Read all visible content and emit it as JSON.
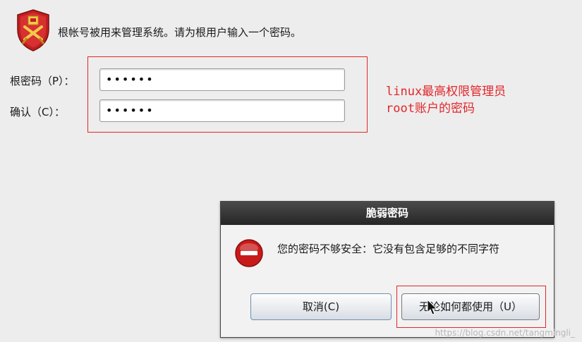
{
  "header": {
    "icon": "shield-lock-icon",
    "text": "根帐号被用来管理系统。请为根用户输入一个密码。"
  },
  "form": {
    "root_password_label": "根密码（P）：",
    "root_password_value": "••••••",
    "confirm_label": "确认（C）：",
    "confirm_value": "••••••"
  },
  "annotation": {
    "line1": "linux最高权限管理员",
    "line2": "root账户的密码",
    "color": "#e2262a"
  },
  "dialog": {
    "title": "脆弱密码",
    "icon": "error-circle-icon",
    "message": "您的密码不够安全：它没有包含足够的不同字符",
    "cancel_label": "取消(C)",
    "use_anyway_label": "无论如何都使用（U）"
  },
  "watermark": "https://blog.csdn.net/tangmingli_"
}
